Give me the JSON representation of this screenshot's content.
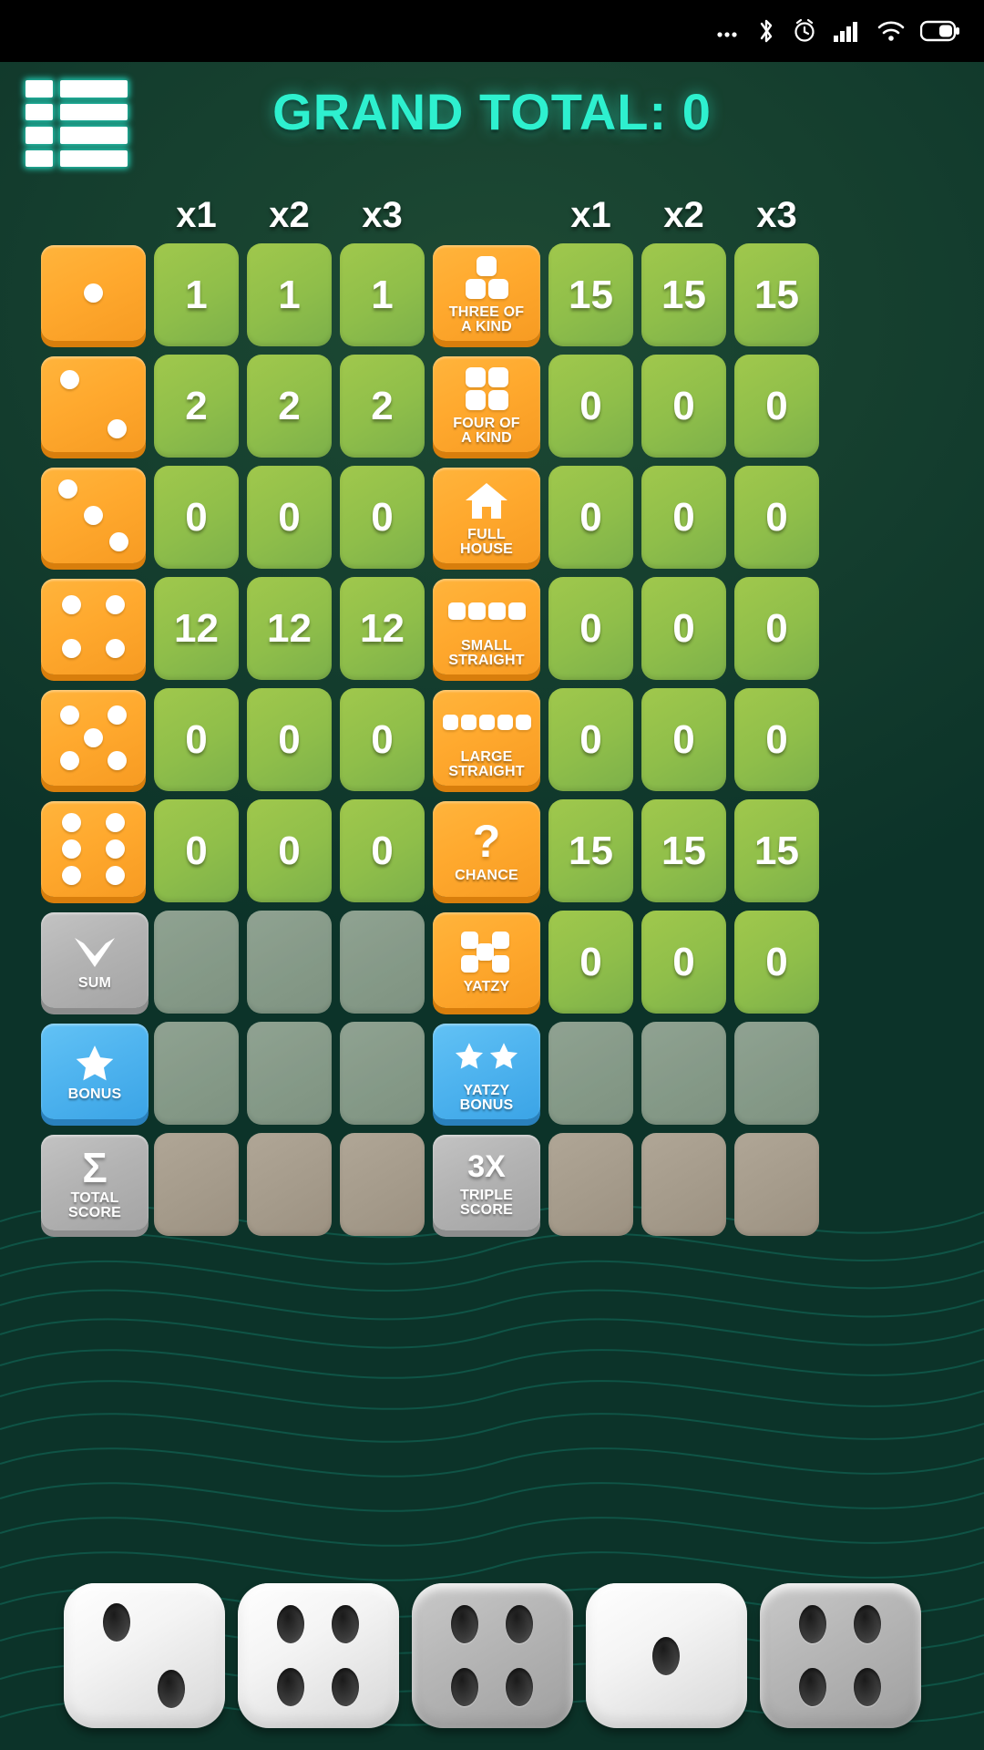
{
  "statusbar": {
    "icons": [
      "more-icon",
      "bluetooth-icon",
      "alarm-icon",
      "signal-icon",
      "wifi-icon",
      "battery-icon"
    ]
  },
  "header": {
    "menu_icon": "menu-list-icon",
    "grand_total_label": "GRAND TOTAL: 0",
    "accent_color": "#2ef0cf"
  },
  "columns": {
    "left_headers": [
      "x1",
      "x2",
      "x3"
    ],
    "right_headers": [
      "x1",
      "x2",
      "x3"
    ]
  },
  "theme": {
    "cell_green": "#8fbe4a",
    "tile_orange": "#ffa92e",
    "tile_blue": "#4fb4ef",
    "tile_grey": "#b3b3b3",
    "background_green": "#0c3329"
  },
  "left_categories": [
    {
      "name": "ones",
      "icon": "die-one-icon",
      "pips": 1,
      "label": "",
      "values": [
        "1",
        "1",
        "1"
      ],
      "state": "active"
    },
    {
      "name": "twos",
      "icon": "die-two-icon",
      "pips": 2,
      "label": "",
      "values": [
        "2",
        "2",
        "2"
      ],
      "state": "active"
    },
    {
      "name": "threes",
      "icon": "die-three-icon",
      "pips": 3,
      "label": "",
      "values": [
        "0",
        "0",
        "0"
      ],
      "state": "active"
    },
    {
      "name": "fours",
      "icon": "die-four-icon",
      "pips": 4,
      "label": "",
      "values": [
        "12",
        "12",
        "12"
      ],
      "state": "active"
    },
    {
      "name": "fives",
      "icon": "die-five-icon",
      "pips": 5,
      "label": "",
      "values": [
        "0",
        "0",
        "0"
      ],
      "state": "active"
    },
    {
      "name": "sixes",
      "icon": "die-six-icon",
      "pips": 6,
      "label": "",
      "values": [
        "0",
        "0",
        "0"
      ],
      "state": "active"
    },
    {
      "name": "sum",
      "icon": "chevron-down-icon",
      "pips": 0,
      "label": "SUM",
      "values": [
        "",
        "",
        ""
      ],
      "state": "disabled"
    },
    {
      "name": "bonus",
      "icon": "star-icon",
      "pips": 0,
      "label": "BONUS",
      "values": [
        "",
        "",
        ""
      ],
      "state": "disabled"
    },
    {
      "name": "total-score",
      "icon": "sigma-icon",
      "pips": 0,
      "label": "TOTAL\nSCORE",
      "values": [
        "",
        "",
        ""
      ],
      "state": "dark"
    }
  ],
  "right_categories": [
    {
      "name": "three-of-a-kind",
      "icon": "three-squares-icon",
      "label": "THREE OF\nA KIND",
      "values": [
        "15",
        "15",
        "15"
      ],
      "state": "active"
    },
    {
      "name": "four-of-a-kind",
      "icon": "four-squares-icon",
      "label": "FOUR OF\nA KIND",
      "values": [
        "0",
        "0",
        "0"
      ],
      "state": "active"
    },
    {
      "name": "full-house",
      "icon": "house-icon",
      "label": "FULL\nHOUSE",
      "values": [
        "0",
        "0",
        "0"
      ],
      "state": "active"
    },
    {
      "name": "small-straight",
      "icon": "four-in-row-icon",
      "label": "SMALL\nSTRAIGHT",
      "values": [
        "0",
        "0",
        "0"
      ],
      "state": "active"
    },
    {
      "name": "large-straight",
      "icon": "five-in-row-icon",
      "label": "LARGE\nSTRAIGHT",
      "values": [
        "0",
        "0",
        "0"
      ],
      "state": "active"
    },
    {
      "name": "chance",
      "icon": "question-mark-icon",
      "label": "CHANCE",
      "values": [
        "15",
        "15",
        "15"
      ],
      "state": "active"
    },
    {
      "name": "yatzy",
      "icon": "five-dice-icon",
      "label": "YATZY",
      "values": [
        "0",
        "0",
        "0"
      ],
      "state": "active"
    },
    {
      "name": "yatzy-bonus",
      "icon": "two-stars-icon",
      "label": "YATZY\nBONUS",
      "values": [
        "",
        "",
        ""
      ],
      "state": "disabled"
    },
    {
      "name": "triple-score",
      "icon": "3x-icon",
      "label": "TRIPLE\nSCORE",
      "badge": "3X",
      "values": [
        "",
        "",
        ""
      ],
      "state": "dark"
    }
  ],
  "dice_tray": [
    {
      "name": "die-1",
      "value": 2,
      "held": false
    },
    {
      "name": "die-2",
      "value": 4,
      "held": false
    },
    {
      "name": "die-3",
      "value": 4,
      "held": true
    },
    {
      "name": "die-4",
      "value": 1,
      "held": false
    },
    {
      "name": "die-5",
      "value": 4,
      "held": true
    }
  ]
}
